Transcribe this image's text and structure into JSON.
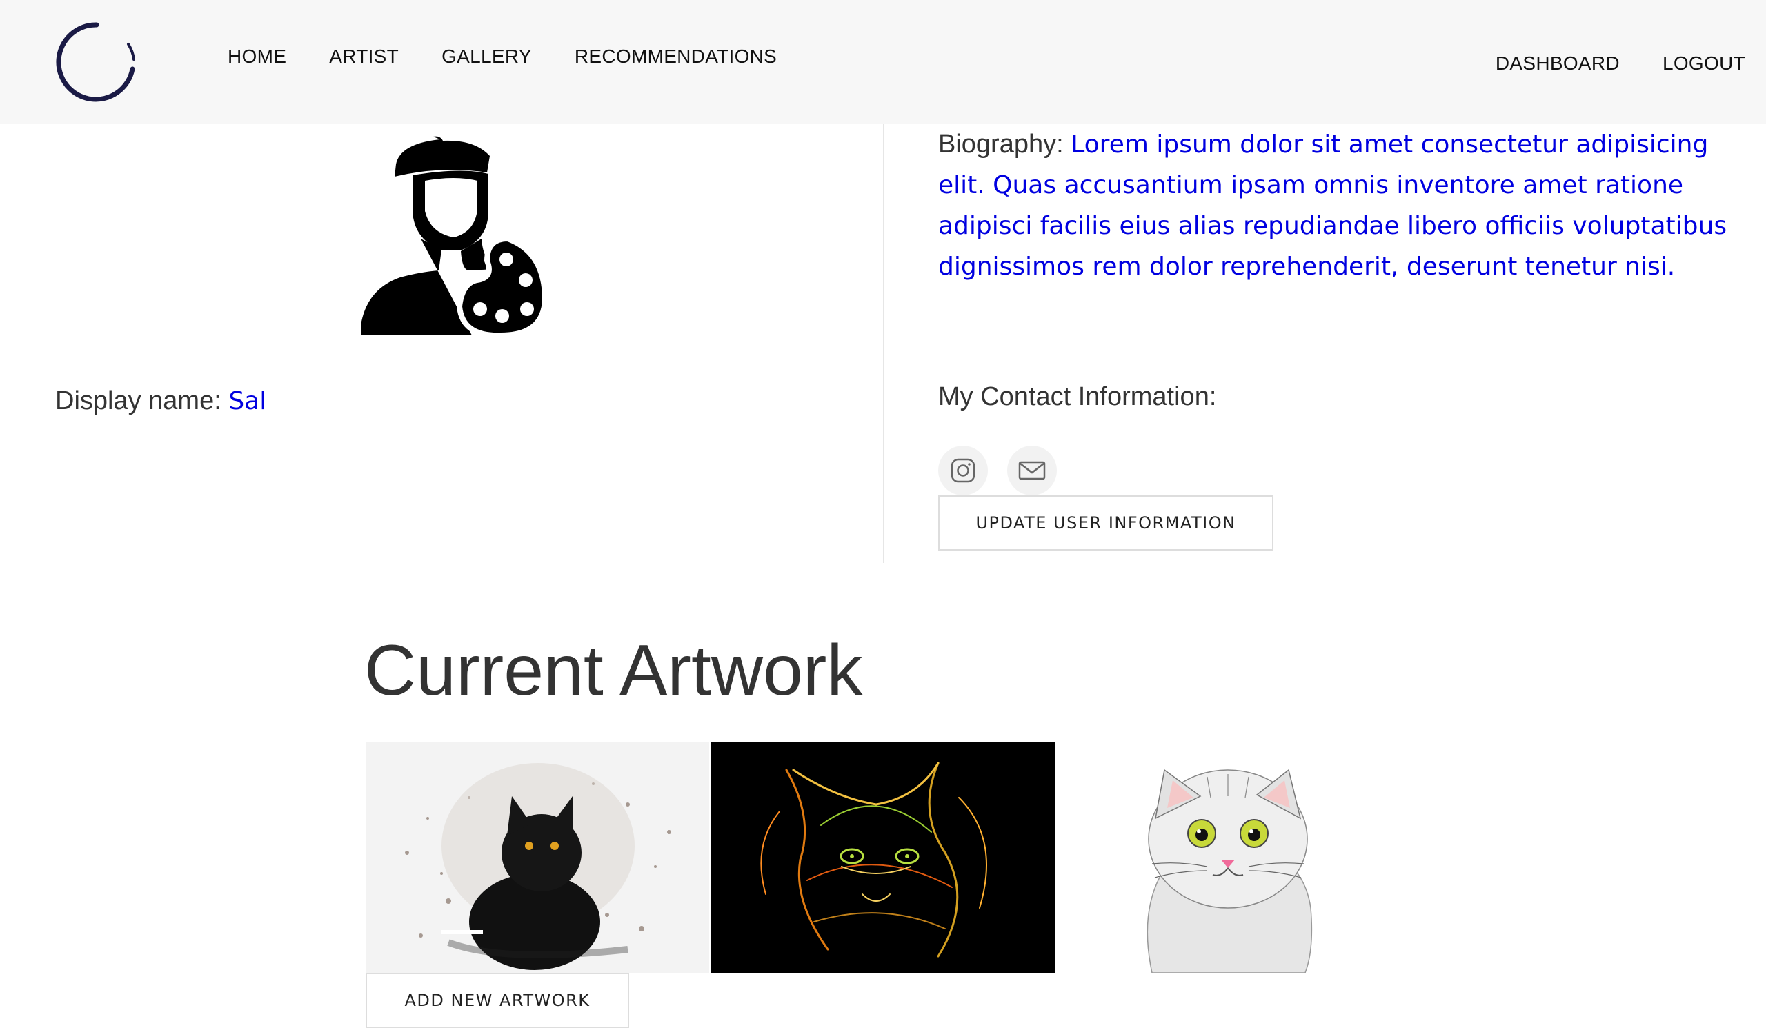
{
  "nav": {
    "left_items": [
      "HOME",
      "ARTIST",
      "GALLERY",
      "RECOMMENDATIONS"
    ],
    "right_items": [
      "DASHBOARD",
      "LOGOUT"
    ]
  },
  "profile": {
    "display_name_label": "Display name:",
    "display_name_value": "Sal",
    "biography_label": "Biography:",
    "biography_value": "Lorem ipsum dolor sit amet consectetur adipisicing elit. Quas accusantium ipsam omnis inventore amet ratione adipisci facilis eius alias repudiandae libero officiis voluptatibus dignissimos rem dolor reprehenderit, deserunt tenetur nisi.",
    "contact_heading": "My Contact Information:",
    "contact_icons": [
      "instagram-icon",
      "email-icon"
    ],
    "update_button": "UPDATE USER INFORMATION"
  },
  "artwork": {
    "heading": "Current Artwork",
    "items": [
      {
        "name": "watercolor-black-cat"
      },
      {
        "name": "neon-fractal-cat"
      },
      {
        "name": "cartoon-grey-cat"
      }
    ],
    "add_button": "ADD NEW ARTWORK"
  },
  "colors": {
    "accent": "#0000e0",
    "navbar_bg": "#f7f7f7",
    "logo": "#1a1a45"
  }
}
